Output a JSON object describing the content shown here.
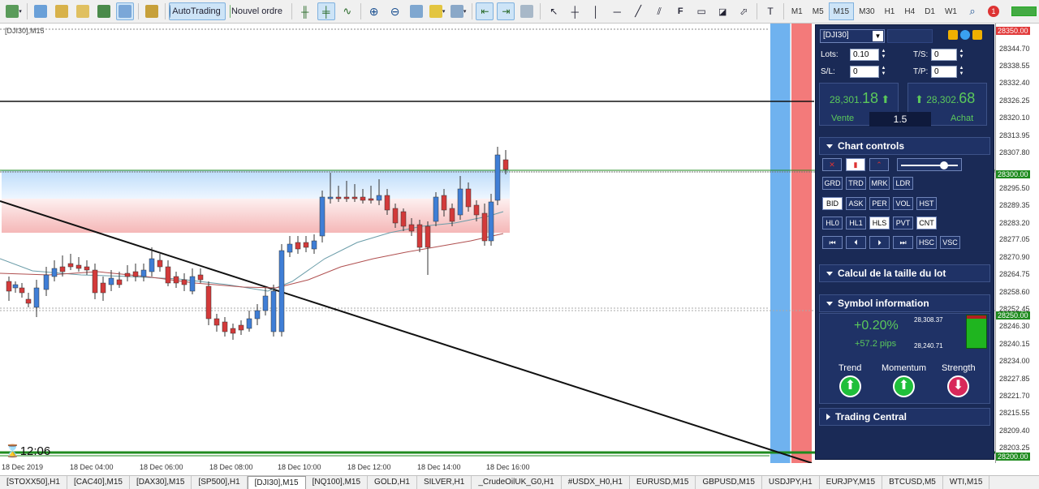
{
  "toolbar": {
    "autotrading_label": "AutoTrading",
    "new_order_label": "Nouvel ordre",
    "timeframes": [
      "M1",
      "M5",
      "M15",
      "M30",
      "H1",
      "H4",
      "D1",
      "W1"
    ],
    "active_timeframe": "M15",
    "alert_count": "1"
  },
  "chart": {
    "title": "[DJI30],M15",
    "clock": "12:06",
    "colors": {
      "bull": "#3f7ed6",
      "bear": "#d33a3a",
      "buy_zone": "#cfe4fb",
      "sell_zone": "#f7c7c7",
      "green_line": "#1f8b1f"
    },
    "price_labels": [
      "28350.00",
      "28344.70",
      "28338.55",
      "28332.40",
      "28326.25",
      "28320.10",
      "28313.95",
      "28307.80",
      "28300.00",
      "28295.50",
      "28289.35",
      "28283.20",
      "28277.05",
      "28270.90",
      "28264.75",
      "28258.60",
      "28252.45",
      "28250.00",
      "28246.30",
      "28240.15",
      "28234.00",
      "28227.85",
      "28221.70",
      "28215.55",
      "28209.40",
      "28203.25",
      "28200.00"
    ],
    "time_labels": [
      "18 Dec 2019",
      "18 Dec 04:00",
      "18 Dec 06:00",
      "18 Dec 08:00",
      "18 Dec 10:00",
      "18 Dec 12:00",
      "18 Dec 14:00",
      "18 Dec 16:00"
    ]
  },
  "panel": {
    "symbol": "[DJI30]",
    "lots_label": "Lots:",
    "lots_value": "0.10",
    "ts_label": "T/S:",
    "ts_value": "0",
    "sl_label": "S/L:",
    "sl_value": "0",
    "tp_label": "T/P:",
    "tp_value": "0",
    "sell_price_main": "28,301.",
    "sell_price_big": "18",
    "buy_price_main": "28,302.",
    "buy_price_big": "68",
    "sell_label": "Vente",
    "buy_label": "Achat",
    "spread": "1.5",
    "chart_controls_title": "Chart controls",
    "row1": [
      "GRD",
      "TRD",
      "MRK",
      "LDR"
    ],
    "row2": [
      "BID",
      "ASK",
      "PER",
      "VOL",
      "HST"
    ],
    "row3": [
      "HL0",
      "HL1",
      "HLS",
      "PVT",
      "CNT"
    ],
    "row4_extra": [
      "HSC",
      "VSC"
    ],
    "lot_calc_title": "Calcul de la taille du lot",
    "symbol_info_title": "Symbol information",
    "change_pct": "+0.20%",
    "change_pips": "+57.2 pips",
    "range_high": "28,308.37",
    "range_low": "28,240.71",
    "trend_label": "Trend",
    "momentum_label": "Momentum",
    "strength_label": "Strength",
    "trading_central_title": "Trading Central"
  },
  "tabs": [
    "[STOXX50],H1",
    "[CAC40],M15",
    "[DAX30],M15",
    "[SP500],H1",
    "[DJI30],M15",
    "[NQ100],M15",
    "GOLD,H1",
    "SILVER,H1",
    "_CrudeOilUK_G0,H1",
    "#USDX_H0,H1",
    "EURUSD,M15",
    "GBPUSD,M15",
    "USDJPY,H1",
    "EURJPY,M15",
    "BTCUSD,M5",
    "WTI,M15"
  ],
  "active_tab": "[DJI30],M15"
}
